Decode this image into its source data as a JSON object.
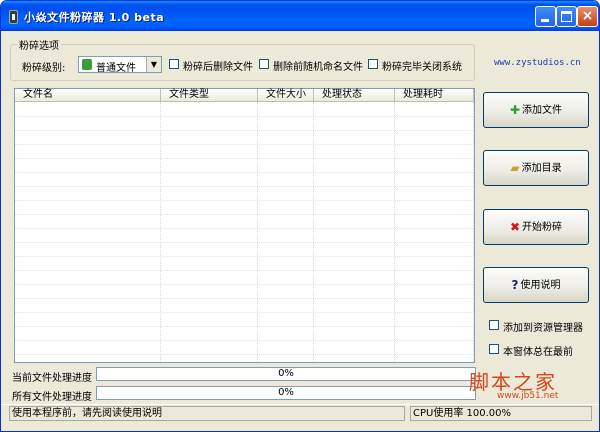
{
  "window": {
    "title": "小焱文件粉碎器 1.0 beta",
    "minimize": "_",
    "maximize": "□",
    "close": "×"
  },
  "options": {
    "group_title": "粉碎选项",
    "level_label": "粉碎级别:",
    "level_value": "普通文件",
    "checkboxes": [
      "粉碎后删除文件",
      "删除前随机命名文件",
      "粉碎完毕关闭系统"
    ]
  },
  "website": "www.zystudios.cn",
  "table": {
    "columns": [
      "文件名",
      "文件类型",
      "文件大小",
      "处理状态",
      "处理耗时"
    ]
  },
  "buttons": {
    "add_file": "添加文件",
    "add_dir": "添加目录",
    "start": "开始粉碎",
    "help": "使用说明"
  },
  "side_options": [
    "添加到资源管理器",
    "本窗体总在最前"
  ],
  "progress": {
    "current_label": "当前文件处理进度",
    "current_value": "0%",
    "all_label": "所有文件处理进度",
    "all_value": "0%"
  },
  "status": {
    "left": "使用本程序前，请先阅读使用说明",
    "right": "CPU使用率 100.00%"
  },
  "watermark": {
    "text": "脚本之家",
    "url": "www.jb51.net"
  }
}
